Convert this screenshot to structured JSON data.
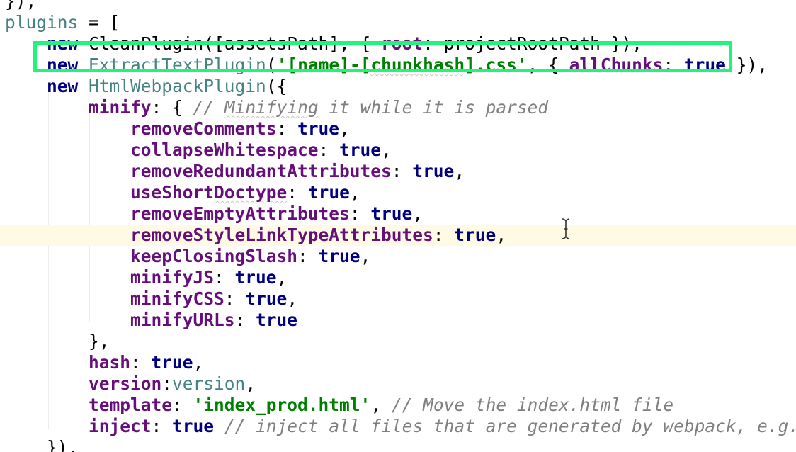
{
  "editor": {
    "lines": [
      {
        "tokens": [
          {
            "t": "}),",
            "k": "plain"
          }
        ]
      },
      {
        "tokens": [
          {
            "t": "plugins",
            "k": "ident"
          },
          {
            "t": " = [",
            "k": "plain"
          }
        ]
      },
      {
        "tokens": [
          {
            "t": "    ",
            "k": "plain"
          },
          {
            "t": "new",
            "k": "kw"
          },
          {
            "t": " CleanPlugin([assetsPath], { ",
            "k": "plain"
          },
          {
            "t": "root",
            "k": "prop"
          },
          {
            "t": ": projectRootPath }),",
            "k": "plain"
          }
        ]
      },
      {
        "tokens": [
          {
            "t": "    ",
            "k": "plain"
          },
          {
            "t": "new",
            "k": "kw"
          },
          {
            "t": " ",
            "k": "plain"
          },
          {
            "t": "ExtractTextPlugin",
            "k": "ident"
          },
          {
            "t": "(",
            "k": "plain"
          },
          {
            "t": "'[name]-[",
            "k": "str"
          },
          {
            "t": "chunkhash",
            "k": "str",
            "typo": true
          },
          {
            "t": "].css'",
            "k": "str"
          },
          {
            "t": ", { ",
            "k": "plain"
          },
          {
            "t": "allChunks",
            "k": "prop"
          },
          {
            "t": ": ",
            "k": "plain"
          },
          {
            "t": "true",
            "k": "kw"
          },
          {
            "t": " }),",
            "k": "plain"
          }
        ]
      },
      {
        "tokens": [
          {
            "t": "    ",
            "k": "plain"
          },
          {
            "t": "new",
            "k": "kw"
          },
          {
            "t": " ",
            "k": "plain"
          },
          {
            "t": "HtmlWebpackPlugin",
            "k": "ident"
          },
          {
            "t": "({",
            "k": "plain"
          }
        ]
      },
      {
        "tokens": [
          {
            "t": "        ",
            "k": "plain"
          },
          {
            "t": "minify",
            "k": "prop"
          },
          {
            "t": ": { ",
            "k": "plain"
          },
          {
            "t": "// ",
            "k": "cmt"
          },
          {
            "t": "Minifying",
            "k": "cmt",
            "typo": true
          },
          {
            "t": " it while it is parsed",
            "k": "cmt"
          }
        ]
      },
      {
        "tokens": [
          {
            "t": "            ",
            "k": "plain"
          },
          {
            "t": "removeComments",
            "k": "prop"
          },
          {
            "t": ": ",
            "k": "plain"
          },
          {
            "t": "true",
            "k": "kw"
          },
          {
            "t": ",",
            "k": "plain"
          }
        ]
      },
      {
        "tokens": [
          {
            "t": "            ",
            "k": "plain"
          },
          {
            "t": "collapseWhitespace",
            "k": "prop"
          },
          {
            "t": ": ",
            "k": "plain"
          },
          {
            "t": "true",
            "k": "kw"
          },
          {
            "t": ",",
            "k": "plain"
          }
        ]
      },
      {
        "tokens": [
          {
            "t": "            ",
            "k": "plain"
          },
          {
            "t": "removeRedundantAttributes",
            "k": "prop"
          },
          {
            "t": ": ",
            "k": "plain"
          },
          {
            "t": "true",
            "k": "kw"
          },
          {
            "t": ",",
            "k": "plain"
          }
        ]
      },
      {
        "tokens": [
          {
            "t": "            ",
            "k": "plain"
          },
          {
            "t": "useShort",
            "k": "prop"
          },
          {
            "t": "Doctype",
            "k": "prop",
            "typo": true
          },
          {
            "t": ": ",
            "k": "plain"
          },
          {
            "t": "true",
            "k": "kw"
          },
          {
            "t": ",",
            "k": "plain"
          }
        ]
      },
      {
        "tokens": [
          {
            "t": "            ",
            "k": "plain"
          },
          {
            "t": "removeEmptyAttributes",
            "k": "prop"
          },
          {
            "t": ": ",
            "k": "plain"
          },
          {
            "t": "true",
            "k": "kw"
          },
          {
            "t": ",",
            "k": "plain"
          }
        ]
      },
      {
        "caret": true,
        "tokens": [
          {
            "t": "            ",
            "k": "plain"
          },
          {
            "t": "removeStyleLinkTypeAttributes",
            "k": "prop"
          },
          {
            "t": ": ",
            "k": "plain"
          },
          {
            "t": "true",
            "k": "kw"
          },
          {
            "t": ",",
            "k": "plain"
          }
        ]
      },
      {
        "tokens": [
          {
            "t": "            ",
            "k": "plain"
          },
          {
            "t": "keepClosingSlash",
            "k": "prop"
          },
          {
            "t": ": ",
            "k": "plain"
          },
          {
            "t": "true",
            "k": "kw"
          },
          {
            "t": ",",
            "k": "plain"
          }
        ]
      },
      {
        "tokens": [
          {
            "t": "            ",
            "k": "plain"
          },
          {
            "t": "minifyJS",
            "k": "prop"
          },
          {
            "t": ": ",
            "k": "plain"
          },
          {
            "t": "true",
            "k": "kw"
          },
          {
            "t": ",",
            "k": "plain"
          }
        ]
      },
      {
        "tokens": [
          {
            "t": "            ",
            "k": "plain"
          },
          {
            "t": "minifyCSS",
            "k": "prop"
          },
          {
            "t": ": ",
            "k": "plain"
          },
          {
            "t": "true",
            "k": "kw"
          },
          {
            "t": ",",
            "k": "plain"
          }
        ]
      },
      {
        "tokens": [
          {
            "t": "            ",
            "k": "plain"
          },
          {
            "t": "minifyURLs",
            "k": "prop"
          },
          {
            "t": ": ",
            "k": "plain"
          },
          {
            "t": "true",
            "k": "kw"
          }
        ]
      },
      {
        "tokens": [
          {
            "t": "        ",
            "k": "plain"
          },
          {
            "t": "},",
            "k": "plain"
          }
        ]
      },
      {
        "tokens": [
          {
            "t": "        ",
            "k": "plain"
          },
          {
            "t": "hash",
            "k": "prop"
          },
          {
            "t": ": ",
            "k": "plain"
          },
          {
            "t": "true",
            "k": "kw"
          },
          {
            "t": ",",
            "k": "plain"
          }
        ]
      },
      {
        "tokens": [
          {
            "t": "        ",
            "k": "plain"
          },
          {
            "t": "version",
            "k": "prop"
          },
          {
            "t": ":",
            "k": "plain"
          },
          {
            "t": "version",
            "k": "ident"
          },
          {
            "t": ",",
            "k": "plain"
          }
        ]
      },
      {
        "tokens": [
          {
            "t": "        ",
            "k": "plain"
          },
          {
            "t": "template",
            "k": "prop"
          },
          {
            "t": ": ",
            "k": "plain"
          },
          {
            "t": "'index_prod.html'",
            "k": "str"
          },
          {
            "t": ", ",
            "k": "plain"
          },
          {
            "t": "// Move the index.html file",
            "k": "cmt"
          }
        ]
      },
      {
        "tokens": [
          {
            "t": "        ",
            "k": "plain"
          },
          {
            "t": "inject",
            "k": "prop"
          },
          {
            "t": ": ",
            "k": "plain"
          },
          {
            "t": "true",
            "k": "kw"
          },
          {
            "t": " ",
            "k": "plain"
          },
          {
            "t": "// inject all files that are generated by webpack, e.g. bun",
            "k": "cmt"
          }
        ]
      },
      {
        "tokens": [
          {
            "t": "    ",
            "k": "plain"
          },
          {
            "t": "}),",
            "k": "plain"
          }
        ]
      }
    ]
  },
  "highlight": {
    "color": "#21f47a"
  },
  "colors": {
    "keyword": "#000080",
    "property": "#660e7a",
    "string": "#008000",
    "comment": "#808080",
    "identifier": "#458383",
    "caret_row": "#fffae3"
  },
  "pointer": {
    "icon": "text-cursor-icon"
  }
}
